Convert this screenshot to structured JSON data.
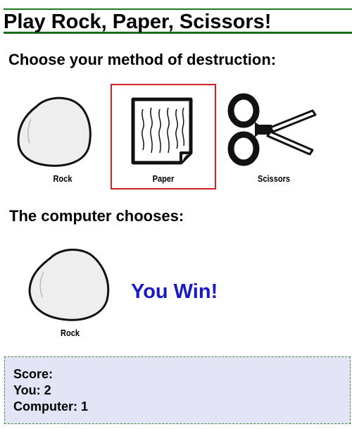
{
  "header": {
    "title": "Play Rock, Paper, Scissors!"
  },
  "player": {
    "prompt": "Choose your method of destruction:",
    "choices": [
      {
        "label": "Rock",
        "icon": "rock-icon",
        "selected": false
      },
      {
        "label": "Paper",
        "icon": "paper-icon",
        "selected": true
      },
      {
        "label": "Scissors",
        "icon": "scissors-icon",
        "selected": false
      }
    ],
    "selected_color": "#d81f1f"
  },
  "computer": {
    "title": "The computer chooses:",
    "choice_label": "Rock",
    "choice_icon": "rock-icon"
  },
  "result": {
    "text": "You Win!",
    "color": "#1919c8"
  },
  "score": {
    "heading": "Score:",
    "you": "You: 2",
    "computer": "Computer: 1"
  }
}
